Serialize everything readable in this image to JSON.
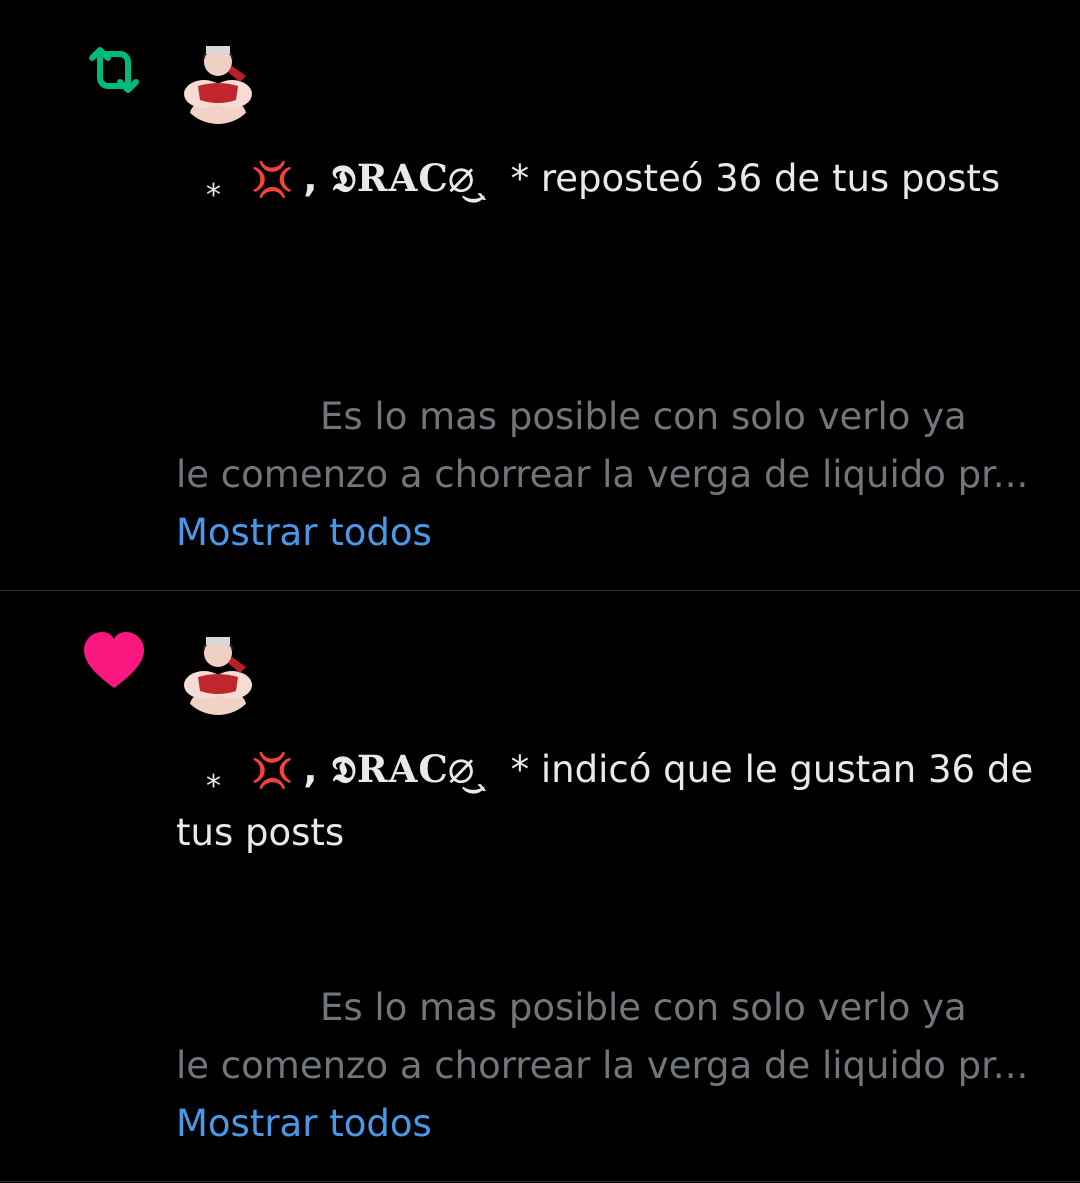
{
  "notifications": [
    {
      "type": "repost",
      "type_icon": "repost-icon",
      "icon_color": "#00ba7c",
      "avatar": "user-avatar",
      "actor": {
        "star": "*",
        "emoji": "💢",
        "separator": ",",
        "name": "𝕯RAC∅͜",
        "name_tail": "ˎ",
        "star_after": "*"
      },
      "action_text": "reposteó 36 de tus posts",
      "preview_line1": "Es lo mas posible con solo verlo ya",
      "preview_line2": "le comenzo a chorrear la verga de liquido pr...",
      "show_all": "Mostrar todos"
    },
    {
      "type": "like",
      "type_icon": "heart-icon",
      "icon_color": "#f91880",
      "avatar": "user-avatar",
      "actor": {
        "star": "*",
        "emoji": "💢",
        "separator": ",",
        "name": "𝕯RAC∅͜",
        "name_tail": "ˎ",
        "star_after": "*"
      },
      "action_text": "indicó que le gustan 36 de tus posts",
      "preview_line1": "Es lo mas posible con solo verlo ya",
      "preview_line2": "le comenzo a chorrear la verga de liquido pr...",
      "show_all": "Mostrar todos"
    }
  ]
}
